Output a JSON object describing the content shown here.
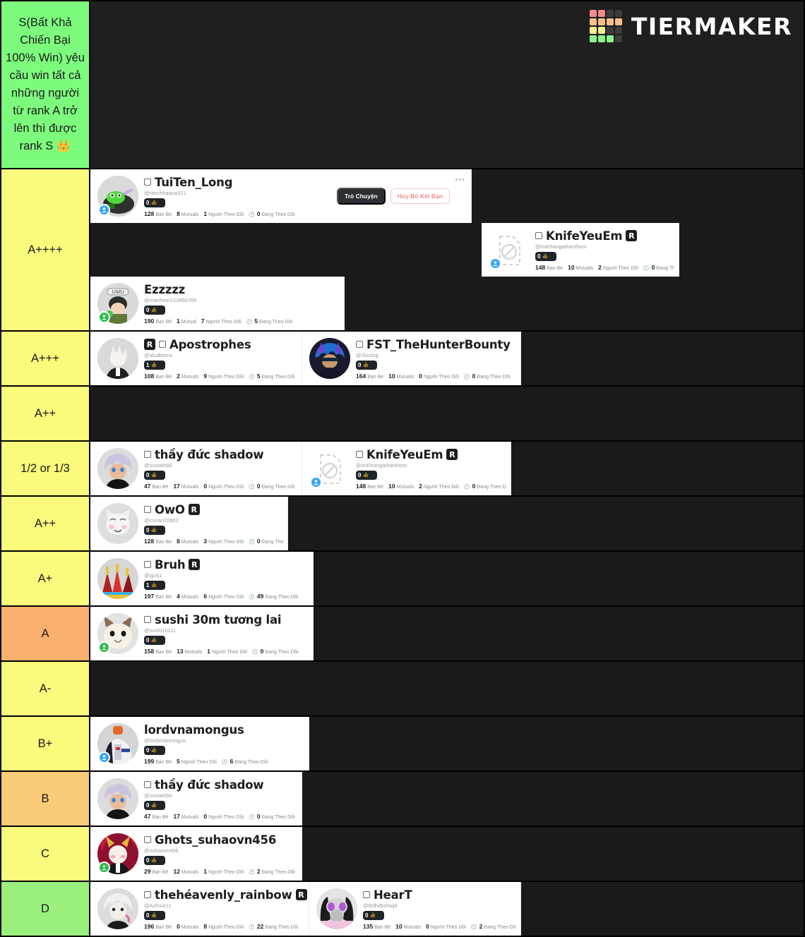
{
  "brand": {
    "name": "TIERMAKER",
    "grid_colors": [
      "#f58b8b",
      "#f58b8b",
      "#3d3d3d",
      "#3d3d3d",
      "#f5c08b",
      "#f5c08b",
      "#f5c08b",
      "#f5c08b",
      "#f5ef8b",
      "#f5ef8b",
      "#3d3d3d",
      "#3d3d3d",
      "#8bf58b",
      "#8bf58b",
      "#8bf58b",
      "#3d3d3d"
    ]
  },
  "stat_labels": {
    "friends": "Bạn Bè",
    "mutuals": "Mutuals",
    "mutual_single": "Mutual",
    "followers": "Người Theo Dõi",
    "following": "Đang Theo Dõi"
  },
  "actions": {
    "chat": "Trò Chuyện",
    "unfriend": "Hủy Bỏ Kết Bạn",
    "more": "•••"
  },
  "tiers": [
    {
      "label": "S(Bất Khả Chiến Bại 100% Win) yêu cầu win tất cả những người từ rank A trở lên thì được rank S 👑",
      "color": "#7dfb7d",
      "header": true,
      "items": []
    },
    {
      "label": "A++++",
      "color": "#fafa7d",
      "items": [
        {
          "name": "TuiTen_Long",
          "handle": "@ranchhaqua321",
          "badge": "0",
          "friends": "128",
          "mutuals": "8",
          "mutuals_label": "Mutuals",
          "followers": "1",
          "following": "0",
          "verified_box": true,
          "premium": false,
          "avatar": "frog-green",
          "dot": "blue",
          "width": "w-lg",
          "actions": true
        },
        {
          "name": "KnifeYeuEm",
          "handle": "@imKhangathanthom",
          "badge": "0",
          "friends": "148",
          "mutuals": "10",
          "mutuals_label": "Mutuals",
          "followers": "2",
          "following": "0",
          "verified_box": true,
          "premium": true,
          "avatar": "missing",
          "dot": "blue",
          "width": "w-xs",
          "actions": false,
          "offset": 554
        },
        {
          "name": "Ezzzzz",
          "handle": "@manhem123456789",
          "badge": "0",
          "friends": "190",
          "mutuals": "1",
          "mutuals_label": "Mutual",
          "followers": "7",
          "following": "5",
          "verified_box": false,
          "premium": false,
          "avatar": "uwu",
          "dot": "green",
          "width": "w-sm",
          "actions": false
        }
      ]
    },
    {
      "label": "A+++",
      "color": "#fafa7d",
      "items": [
        {
          "name": "Apostrophes",
          "handle": "@aludbemz",
          "badge": "1",
          "friends": "108",
          "mutuals": "2",
          "mutuals_label": "Mutuals",
          "followers": "9",
          "following": "5",
          "verified_box": true,
          "premium": true,
          "premium_first": true,
          "avatar": "white-hair",
          "dot": "none",
          "width": "w-md",
          "actions": false
        },
        {
          "name": "FST_TheHunterBounty",
          "handle": "@2krolzg",
          "badge": "0",
          "friends": "164",
          "mutuals": "10",
          "mutuals_label": "Mutuals",
          "followers": "0",
          "following": "0",
          "verified_box": true,
          "premium": false,
          "avatar": "blue-hair",
          "dot": "none",
          "width": "w-310",
          "actions": false
        }
      ]
    },
    {
      "label": "A++",
      "color": "#fafa7d",
      "items": []
    },
    {
      "label": "1/2 or 1/3",
      "color": "#fafa7d",
      "items": [
        {
          "name": "thầy đức shadow",
          "handle": "@sustaihb0",
          "badge": "0",
          "friends": "47",
          "mutuals": "17",
          "mutuals_label": "Mutuals",
          "followers": "0",
          "following": "0",
          "verified_box": true,
          "premium": false,
          "avatar": "lavender-hair",
          "dot": "none",
          "width": "w-md",
          "actions": false
        },
        {
          "name": "KnifeYeuEm",
          "handle": "@imKhangathanthom",
          "badge": "0",
          "friends": "148",
          "mutuals": "10",
          "mutuals_label": "Mutuals",
          "followers": "2",
          "following": "0",
          "verified_box": true,
          "premium": true,
          "avatar": "missing",
          "dot": "blue",
          "width": "w-296",
          "actions": false
        }
      ]
    },
    {
      "label": "A++",
      "color": "#fafa7d",
      "items": [
        {
          "name": "OwO",
          "handle": "@conan20802",
          "badge": "0",
          "friends": "128",
          "mutuals": "8",
          "mutuals_label": "Mutuals",
          "followers": "3",
          "following": "0",
          "verified_box": true,
          "premium": true,
          "avatar": "cat-white",
          "dot": "none",
          "width": "w-xs",
          "actions": false
        }
      ]
    },
    {
      "label": "A+",
      "color": "#fafa7d",
      "items": [
        {
          "name": "Bruh",
          "handle": "@jgvtj1",
          "badge": "1",
          "friends": "197",
          "mutuals": "4",
          "mutuals_label": "Mutuals",
          "followers": "6",
          "following": "49",
          "verified_box": true,
          "premium": true,
          "avatar": "red-armor",
          "dot": "none",
          "width": "w-316",
          "actions": false
        }
      ]
    },
    {
      "label": "A",
      "color": "#f9b06e",
      "items": [
        {
          "name": "sushi 30m tương lai",
          "handle": "@sushi16111",
          "badge": "0",
          "friends": "158",
          "mutuals": "13",
          "mutuals_label": "Mutuals",
          "followers": "1",
          "following": "0",
          "verified_box": true,
          "premium": false,
          "avatar": "cat-face",
          "dot": "green",
          "width": "w-316",
          "actions": false
        }
      ]
    },
    {
      "label": "A-",
      "color": "#fafa7d",
      "items": []
    },
    {
      "label": "B+",
      "color": "#fafa7d",
      "items": [
        {
          "name": "lordvnamongus",
          "handle": "@lordvnamongus",
          "badge": "0",
          "friends": "199",
          "mutuals": "",
          "mutuals_label": "",
          "followers": "5",
          "following": "6",
          "verified_box": false,
          "premium": false,
          "avatar": "mecha-white",
          "dot": "blue",
          "width": "w-310",
          "actions": false
        }
      ]
    },
    {
      "label": "B",
      "color": "#f9cb77",
      "items": [
        {
          "name": "thầy đức shadow",
          "handle": "@sustaihb0",
          "badge": "0",
          "friends": "47",
          "mutuals": "17",
          "mutuals_label": "Mutuals",
          "followers": "0",
          "following": "0",
          "verified_box": true,
          "premium": false,
          "avatar": "lavender-hair",
          "dot": "none",
          "width": "w-md",
          "actions": false
        }
      ]
    },
    {
      "label": "C",
      "color": "#fafa7d",
      "items": [
        {
          "name": "Ghots_suhaovn456",
          "handle": "@suhaovn456",
          "badge": "0",
          "friends": "29",
          "mutuals": "12",
          "mutuals_label": "Mutuals",
          "followers": "1",
          "following": "2",
          "verified_box": true,
          "premium": false,
          "avatar": "crimson-demon",
          "dot": "green",
          "width": "w-md",
          "actions": false
        }
      ]
    },
    {
      "label": "D",
      "color": "#9bf07d",
      "items": [
        {
          "name": "thehéavenly_rainbow",
          "handle": "@Anhsia11",
          "badge": "0",
          "friends": "196",
          "mutuals": "0",
          "mutuals_label": "Mutuals",
          "followers": "8",
          "following": "22",
          "verified_box": true,
          "premium": true,
          "avatar": "silver-hair",
          "dot": "none",
          "width": "w-310",
          "actions": false
        },
        {
          "name": "HearT",
          "handle": "@Bdhdbshwjd",
          "badge": "0",
          "friends": "135",
          "mutuals": "10",
          "mutuals_label": "Mutuals",
          "followers": "0",
          "following": "2",
          "verified_box": true,
          "premium": false,
          "avatar": "gasmask",
          "dot": "none",
          "width": "w-md",
          "actions": false
        }
      ]
    }
  ]
}
